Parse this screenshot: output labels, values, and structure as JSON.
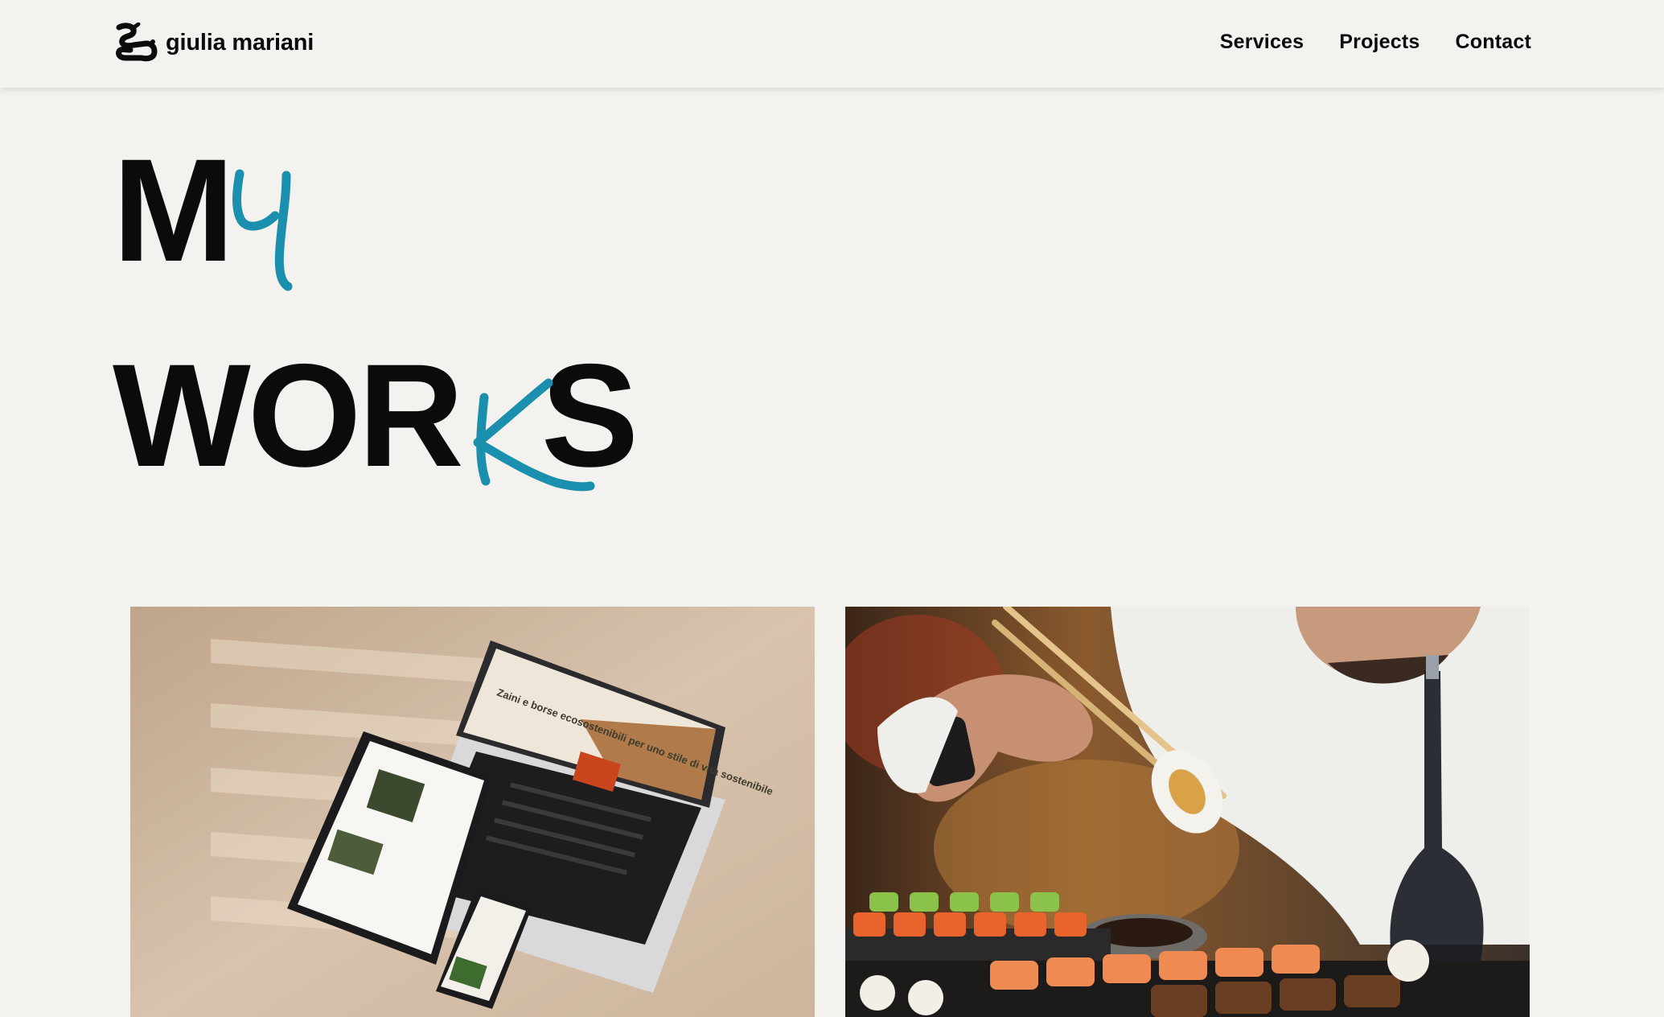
{
  "header": {
    "brand_name": "giulia mariani",
    "nav": [
      {
        "label": "Services"
      },
      {
        "label": "Projects"
      },
      {
        "label": "Contact"
      }
    ]
  },
  "hero": {
    "line1_printed": "M",
    "line1_handwritten": "y",
    "line2_before": "WOR",
    "line2_handwritten": "k",
    "line2_after": "S",
    "accent_color": "#1b8fae"
  },
  "projects": [
    {
      "image": "device-mockup-laptop-tablet-phone",
      "screen_text": "Zaini e borse ecosostenibili per uno stile di vita sostenibile"
    },
    {
      "image": "sushi-chopsticks-photo"
    }
  ]
}
